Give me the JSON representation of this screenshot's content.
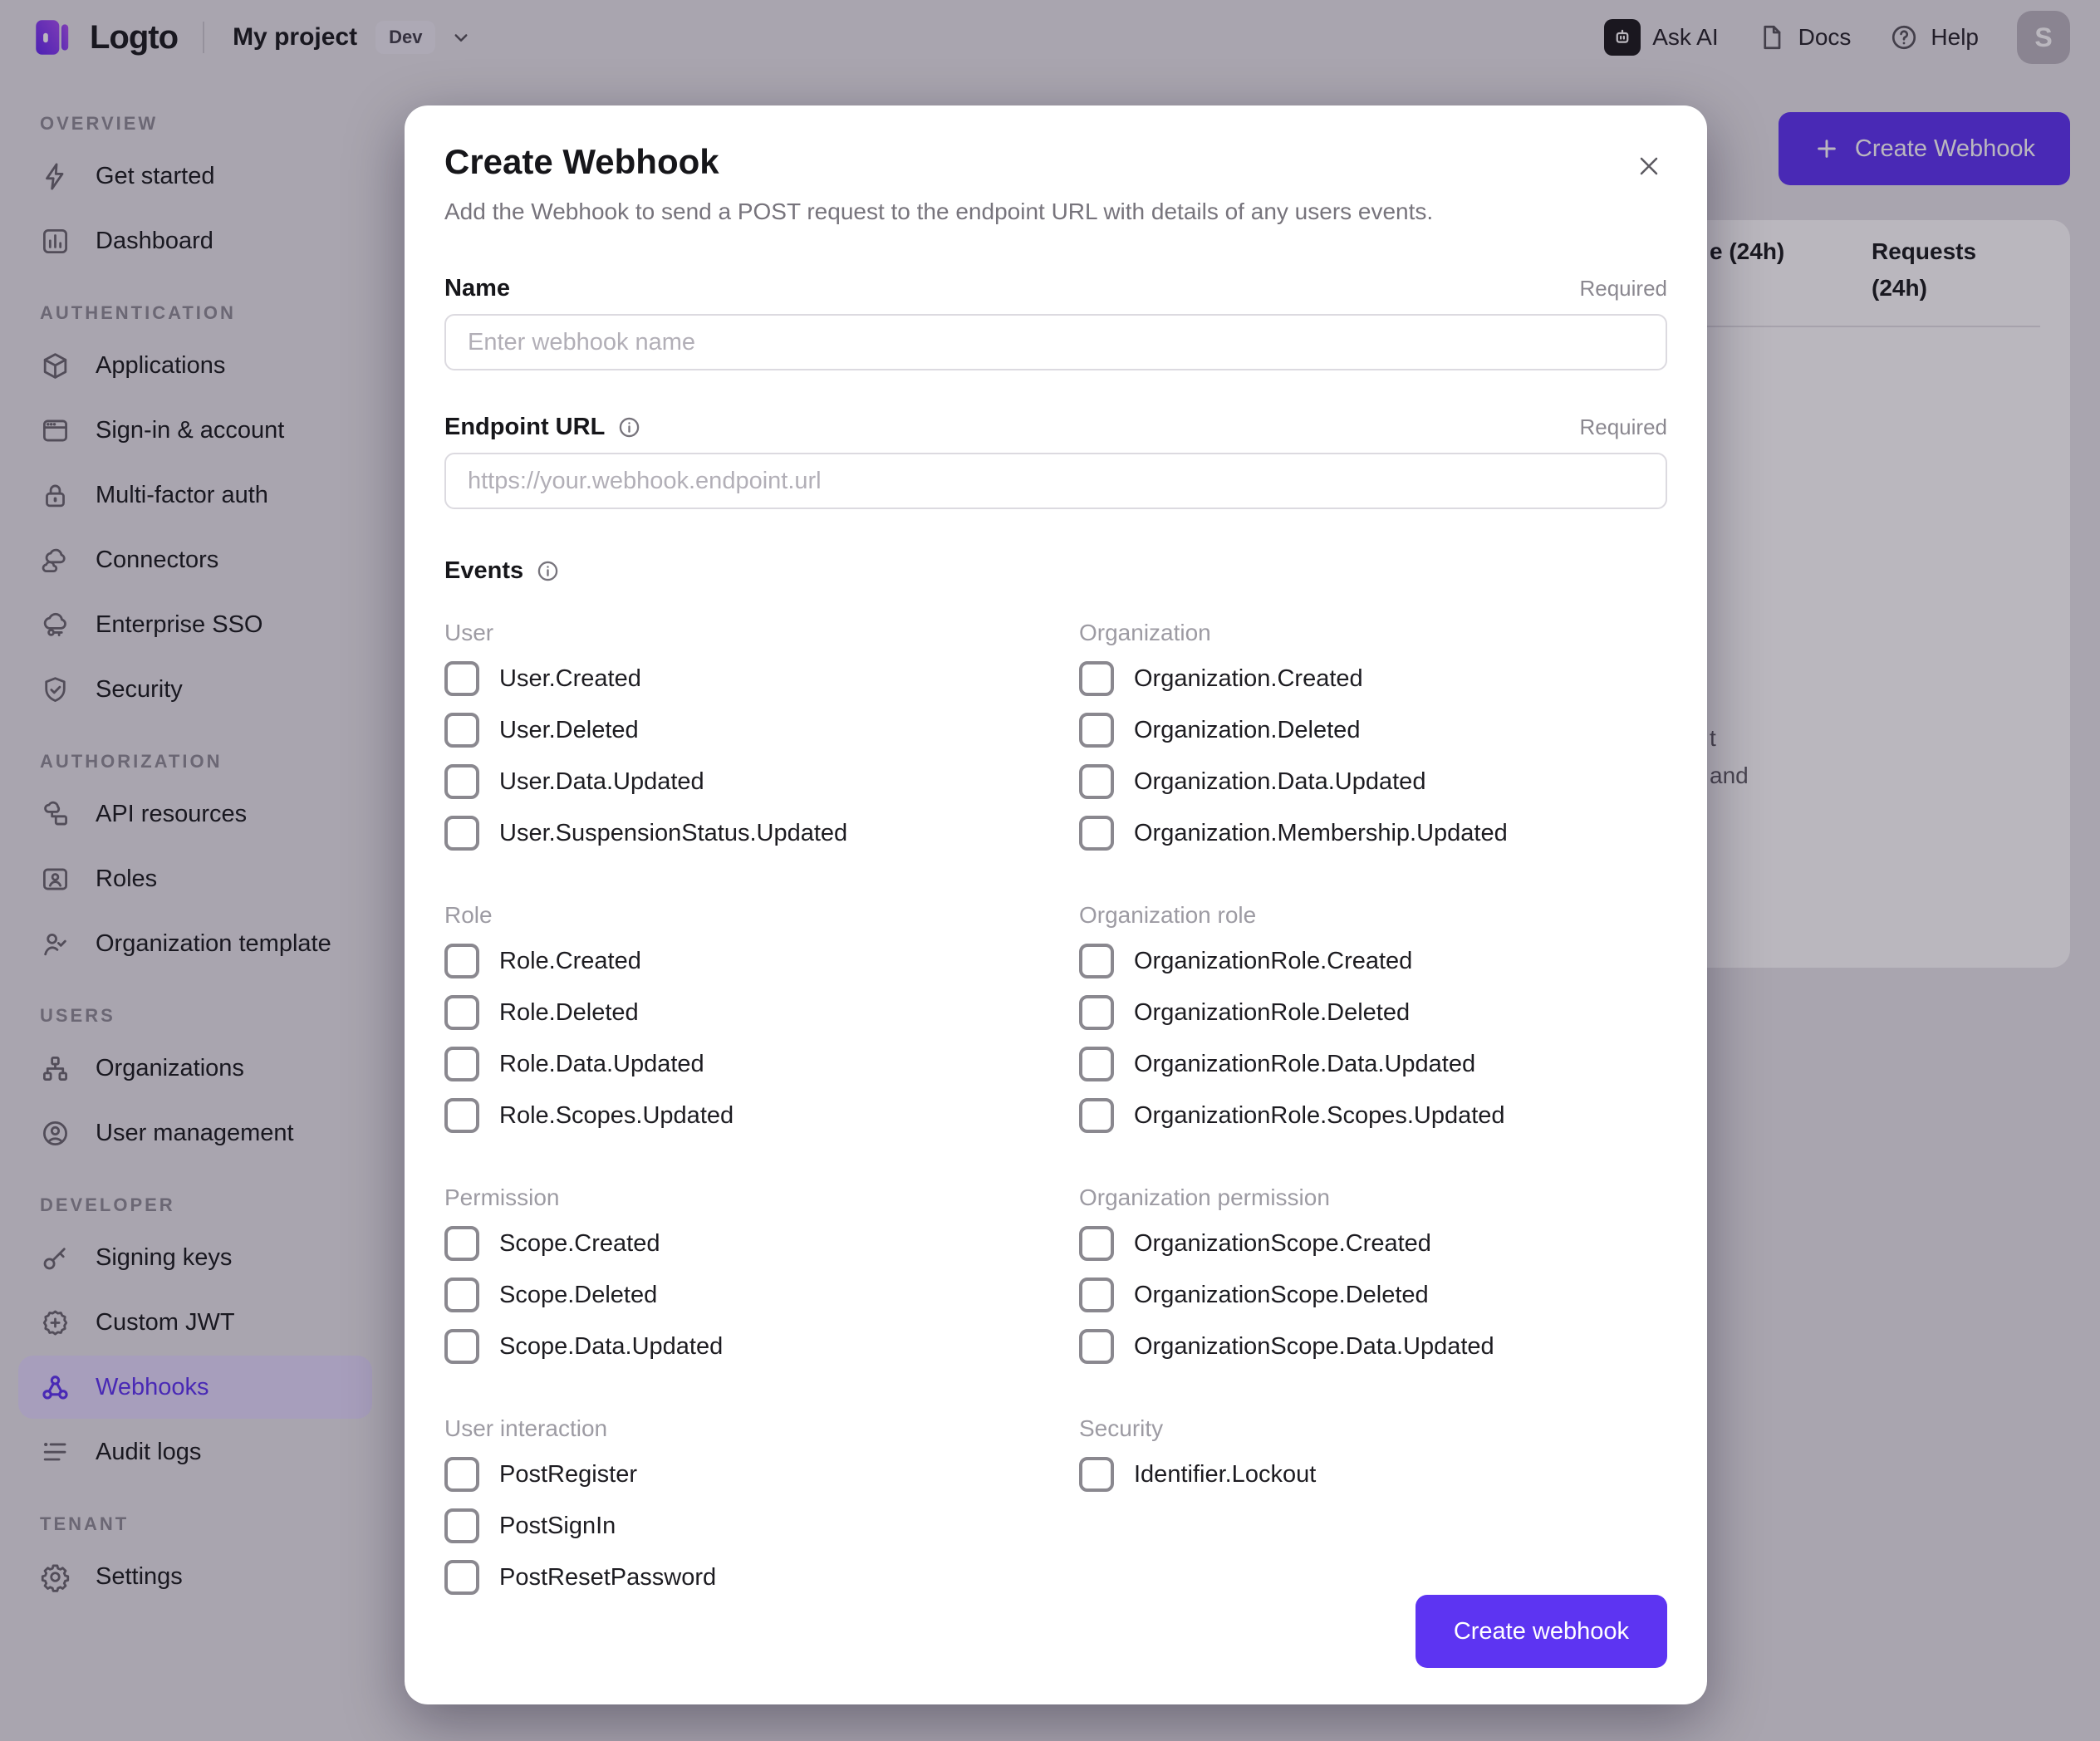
{
  "topbar": {
    "brand": "Logto",
    "project_name": "My project",
    "env_badge": "Dev",
    "ask_ai_label": "Ask AI",
    "docs_label": "Docs",
    "help_label": "Help",
    "avatar_initial": "S"
  },
  "sidebar": {
    "sections": [
      {
        "label": "OVERVIEW",
        "items": [
          {
            "label": "Get started",
            "icon": "lightning-icon"
          },
          {
            "label": "Dashboard",
            "icon": "dashboard-icon"
          }
        ]
      },
      {
        "label": "AUTHENTICATION",
        "items": [
          {
            "label": "Applications",
            "icon": "box-icon"
          },
          {
            "label": "Sign-in & account",
            "icon": "browser-window-icon"
          },
          {
            "label": "Multi-factor auth",
            "icon": "lock-icon"
          },
          {
            "label": "Connectors",
            "icon": "connectors-cloud-icon"
          },
          {
            "label": "Enterprise SSO",
            "icon": "cloud-key-icon"
          },
          {
            "label": "Security",
            "icon": "shield-check-icon"
          }
        ]
      },
      {
        "label": "AUTHORIZATION",
        "items": [
          {
            "label": "API resources",
            "icon": "api-resources-icon"
          },
          {
            "label": "Roles",
            "icon": "role-card-icon"
          },
          {
            "label": "Organization template",
            "icon": "person-check-icon"
          }
        ]
      },
      {
        "label": "USERS",
        "items": [
          {
            "label": "Organizations",
            "icon": "org-chart-icon"
          },
          {
            "label": "User management",
            "icon": "user-circle-icon"
          }
        ]
      },
      {
        "label": "DEVELOPER",
        "items": [
          {
            "label": "Signing keys",
            "icon": "key-icon"
          },
          {
            "label": "Custom JWT",
            "icon": "jwt-badge-icon"
          },
          {
            "label": "Webhooks",
            "icon": "webhook-icon",
            "selected": true
          },
          {
            "label": "Audit logs",
            "icon": "audit-log-icon"
          }
        ]
      },
      {
        "label": "TENANT",
        "items": [
          {
            "label": "Settings",
            "icon": "gear-icon"
          }
        ]
      }
    ]
  },
  "page": {
    "create_button_label": "Create Webhook",
    "table_header_fragment": "e (24h)",
    "table_header_requests": "Requests (24h)",
    "empty_text_fragment_1": "t",
    "empty_text_fragment_2": "and"
  },
  "modal": {
    "title": "Create Webhook",
    "subtitle": "Add the Webhook to send a POST request to the endpoint URL with details of any users events.",
    "name_field": {
      "label": "Name",
      "required_tag": "Required",
      "placeholder": "Enter webhook name",
      "value": ""
    },
    "endpoint_field": {
      "label": "Endpoint URL",
      "required_tag": "Required",
      "placeholder": "https://your.webhook.endpoint.url",
      "value": ""
    },
    "events_label": "Events",
    "event_groups": [
      {
        "name": "User",
        "events": [
          "User.Created",
          "User.Deleted",
          "User.Data.Updated",
          "User.SuspensionStatus.Updated"
        ]
      },
      {
        "name": "Organization",
        "events": [
          "Organization.Created",
          "Organization.Deleted",
          "Organization.Data.Updated",
          "Organization.Membership.Updated"
        ]
      },
      {
        "name": "Role",
        "events": [
          "Role.Created",
          "Role.Deleted",
          "Role.Data.Updated",
          "Role.Scopes.Updated"
        ]
      },
      {
        "name": "Organization role",
        "events": [
          "OrganizationRole.Created",
          "OrganizationRole.Deleted",
          "OrganizationRole.Data.Updated",
          "OrganizationRole.Scopes.Updated"
        ]
      },
      {
        "name": "Permission",
        "events": [
          "Scope.Created",
          "Scope.Deleted",
          "Scope.Data.Updated"
        ]
      },
      {
        "name": "Organization permission",
        "events": [
          "OrganizationScope.Created",
          "OrganizationScope.Deleted",
          "OrganizationScope.Data.Updated"
        ]
      },
      {
        "name": "User interaction",
        "events": [
          "PostRegister",
          "PostSignIn",
          "PostResetPassword"
        ]
      },
      {
        "name": "Security",
        "events": [
          "Identifier.Lockout"
        ]
      }
    ],
    "checkboxes_checked": false,
    "submit_label": "Create webhook"
  },
  "colors": {
    "brand": "#5d34f2",
    "selected_nav_bg": "#e4dcfd",
    "overlay": "rgba(25,18,40,0.30)",
    "card_bg": "#ffffff",
    "page_bg": "#e7e5ea"
  }
}
